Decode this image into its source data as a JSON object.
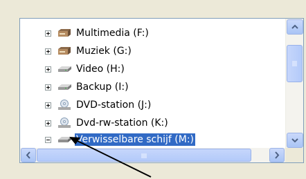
{
  "tree": {
    "items": [
      {
        "label": "Multimedia (F:)",
        "icon": "removable-drive-icon",
        "expander": "plus",
        "selected": false
      },
      {
        "label": "Muziek (G:)",
        "icon": "removable-drive-icon",
        "expander": "plus",
        "selected": false
      },
      {
        "label": "Video (H:)",
        "icon": "hard-drive-icon",
        "expander": "plus",
        "selected": false
      },
      {
        "label": "Backup (I:)",
        "icon": "hard-drive-icon",
        "expander": "plus",
        "selected": false
      },
      {
        "label": "DVD-station (J:)",
        "icon": "dvd-drive-icon",
        "expander": "plus",
        "selected": false
      },
      {
        "label": "Dvd-rw-station (K:)",
        "icon": "dvd-drive-icon",
        "expander": "plus",
        "selected": false
      },
      {
        "label": "Verwisselbare schijf (M:)",
        "icon": "removable-disk-icon",
        "expander": "minus",
        "selected": true
      }
    ]
  },
  "colors": {
    "selection": "#316ac5",
    "scrollbar_accent": "#4d6185"
  }
}
